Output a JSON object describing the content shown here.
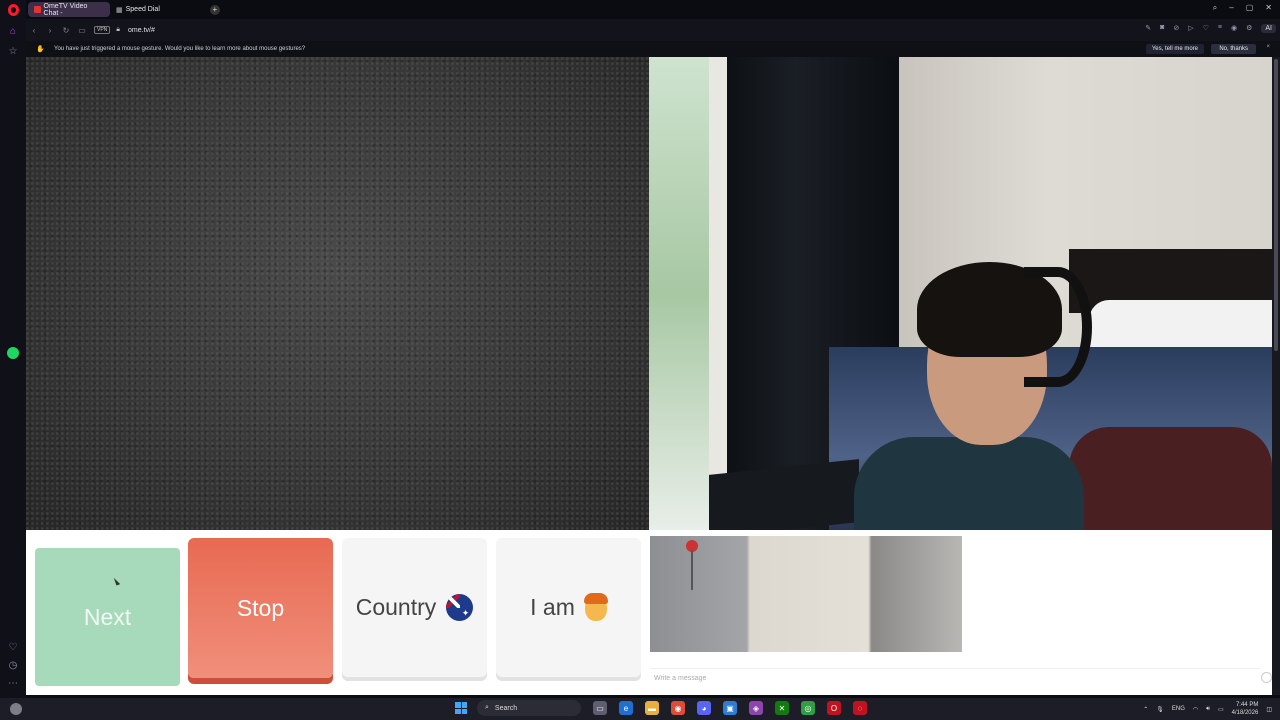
{
  "browser": {
    "tabs": [
      {
        "label": "OmeTV Video Chat -"
      },
      {
        "label": "Speed Dial"
      }
    ],
    "new_tab": "+",
    "vpn": "VPN",
    "url": "ome.tv/#",
    "ai_label": "Aria"
  },
  "notification": {
    "text": "You have just triggered a mouse gesture. Would you like to learn more about mouse gestures?",
    "yes": "Yes, tell me more",
    "no": "No, thanks",
    "close": "×"
  },
  "controls": {
    "next": "Next",
    "stop": "Stop",
    "country": "Country",
    "iam": "I am"
  },
  "chat": {
    "placeholder": "Write a message"
  },
  "taskbar": {
    "search": "Search",
    "language": "ENG",
    "time": "7:44 PM",
    "date": "4/18/2026"
  },
  "colors": {
    "next_bg": "#a7dabb",
    "stop_bg": "#e86a52",
    "opera_red": "#ff1b2d"
  }
}
